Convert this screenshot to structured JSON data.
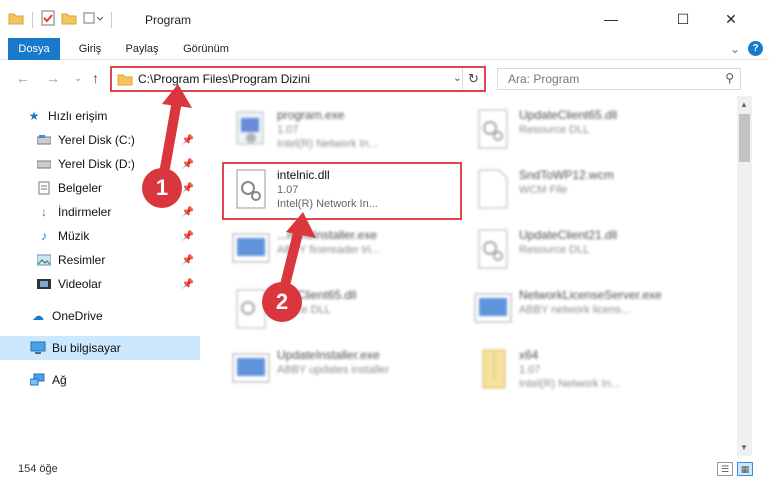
{
  "window": {
    "title": "Program",
    "controls": {
      "minimize": "—",
      "maximize": "☐",
      "close": "✕"
    }
  },
  "ribbon": {
    "tabs": [
      "Dosya",
      "Giriş",
      "Paylaş",
      "Görünüm"
    ],
    "expand": "⌄",
    "help": "?"
  },
  "address": {
    "path": "C:\\Program Files\\Program Dizini",
    "dropdown": "⌄",
    "refresh": "↻"
  },
  "search": {
    "placeholder": "Ara: Program",
    "icon": "⚲"
  },
  "nav": {
    "back": "←",
    "forward": "→",
    "recent": "⌄",
    "up": "↑"
  },
  "sidebar": {
    "quick_access": "Hızlı erişim",
    "items": [
      {
        "label": "Yerel Disk (C:)",
        "pinned": true
      },
      {
        "label": "Yerel Disk (D:)",
        "pinned": true
      },
      {
        "label": "Belgeler",
        "pinned": true
      },
      {
        "label": "İndirmeler",
        "pinned": true
      },
      {
        "label": "Müzik",
        "pinned": true
      },
      {
        "label": "Resimler",
        "pinned": true
      },
      {
        "label": "Videolar",
        "pinned": true
      }
    ],
    "onedrive": "OneDrive",
    "this_pc": "Bu bilgisayar",
    "network": "Ağ"
  },
  "files": [
    {
      "name": "program.exe",
      "line2": "1.07",
      "line3": "Intel(R) Network In...",
      "icon": "exe"
    },
    {
      "name": "UpdateClient65.dll",
      "line2": "Resource DLL",
      "line3": "",
      "icon": "dll"
    },
    {
      "name": "intelnic.dll",
      "line2": "1.07",
      "line3": "Intel(R) Network In...",
      "icon": "dll"
    },
    {
      "name": "SndToWP12.wcm",
      "line2": "WCM File",
      "line3": "",
      "icon": "file"
    },
    {
      "name": "...mmsInstaller.exe",
      "line2": "ABBY finereader tri...",
      "line3": "",
      "icon": "app"
    },
    {
      "name": "UpdateClient21.dll",
      "line2": "Resource DLL",
      "line3": "",
      "icon": "dll"
    },
    {
      "name": "...teClient65.dll",
      "line2": "...urce DLL",
      "line3": "",
      "icon": "dll"
    },
    {
      "name": "NetworkLicenseServer.exe",
      "line2": "ABBY network licens...",
      "line3": "",
      "icon": "app"
    },
    {
      "name": "UpdateInstaller.exe",
      "line2": "ABBY updates installer",
      "line3": "",
      "icon": "app"
    },
    {
      "name": "x64",
      "line2": "1.07",
      "line3": "Intel(R) Network In...",
      "icon": "zip"
    }
  ],
  "status": {
    "count": "154 öğe"
  },
  "markers": [
    "1",
    "2"
  ],
  "colors": {
    "accent": "#1979ca",
    "highlight": "#e0444c",
    "marker": "#d9363e",
    "selected": "#cce8ff"
  }
}
